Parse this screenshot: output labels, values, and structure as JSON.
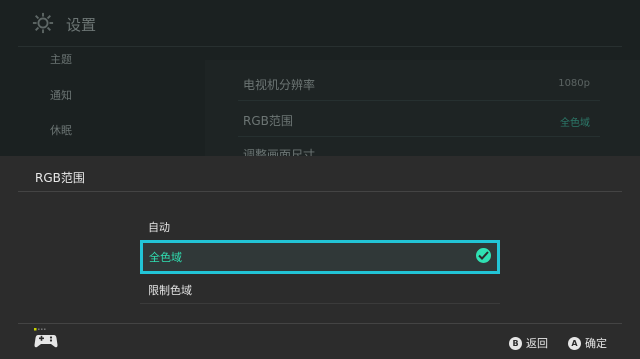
{
  "background": {
    "header_title": "设置",
    "sidebar": [
      "主题",
      "通知",
      "休眠"
    ],
    "rows": [
      {
        "label": "电视机分辨率",
        "value": "1080p"
      },
      {
        "label": "RGB范围",
        "value": "全色域"
      },
      {
        "label": "调整画面尺寸",
        "value": ""
      }
    ]
  },
  "dialog": {
    "title": "RGB范围",
    "options": [
      {
        "label": "自动",
        "selected": false
      },
      {
        "label": "全色域",
        "selected": true
      },
      {
        "label": "限制色域",
        "selected": false
      }
    ]
  },
  "footer": {
    "back_key": "B",
    "back_label": "返回",
    "ok_key": "A",
    "ok_label": "确定"
  },
  "colors": {
    "accent_border": "#22c4d6",
    "selected_text": "#2fe0b2",
    "dialog_bg": "#2c2c2c"
  }
}
